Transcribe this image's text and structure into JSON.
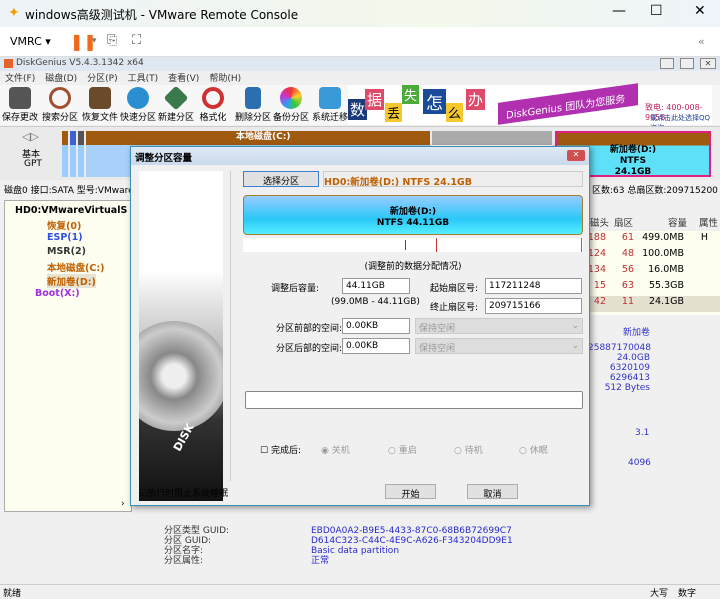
{
  "window": {
    "title": "windows高级测试机 - VMware Remote Console",
    "vmrc_label": "VMRC"
  },
  "app": {
    "title": "DiskGenius V5.4.3.1342 x64"
  },
  "menu": [
    "文件(F)",
    "磁盘(D)",
    "分区(P)",
    "工具(T)",
    "查看(V)",
    "帮助(H)"
  ],
  "toolbar": [
    "保存更改",
    "搜索分区",
    "恢复文件",
    "快速分区",
    "新建分区",
    "格式化",
    "删除分区",
    "备份分区",
    "系统迁移"
  ],
  "banner": {
    "chars": [
      "数",
      "据",
      "丢",
      "失",
      "怎",
      "么",
      "办"
    ],
    "slogan": "DiskGenius 团队为您服务",
    "phone": "致电: 400-008-9958",
    "qq": "或点击此处选择QQ咨询"
  },
  "diskmap": {
    "type_line1": "基本",
    "type_line2": "GPT",
    "c_label": "本地磁盘(C:)",
    "d_label": "新加卷(D:)",
    "d_fs": "NTFS",
    "d_size": "24.1GB"
  },
  "diskinfo": {
    "left": "磁盘0 接口:SATA  型号:VMware",
    "right": "区数:63  总扇区数:209715200"
  },
  "tree": {
    "root": "HD0:VMwareVirtualS",
    "items": [
      "恢复(0)",
      "ESP(1)",
      "MSR(2)",
      "本地磁盘(C:)",
      "新加卷(D:)"
    ],
    "boot": "Boot(X:)"
  },
  "table": {
    "headers": [
      "磁头",
      "扇区",
      "容量",
      "属性"
    ],
    "rows": [
      [
        "188",
        "61",
        "499.0MB",
        "H"
      ],
      [
        "124",
        "48",
        "100.0MB",
        ""
      ],
      [
        "134",
        "56",
        "16.0MB",
        ""
      ],
      [
        "15",
        "63",
        "55.3GB",
        ""
      ],
      [
        "42",
        "11",
        "24.1GB",
        ""
      ]
    ]
  },
  "details": {
    "name": "新加卷",
    "values": [
      "25887170048",
      "24.0GB",
      "6320109",
      "6296413",
      "512 Bytes"
    ],
    "v2": "3.1",
    "v3": "4096"
  },
  "bottom": {
    "labels": [
      "分区类型 GUID:",
      "分区 GUID:",
      "分区名字:",
      "分区属性:"
    ],
    "values": [
      "EBD0A0A2-B9E5-4433-87C0-68B6B72699C7",
      "D614C323-C44C-4E9C-A626-F343204DD9E1",
      "Basic data partition",
      "正常"
    ]
  },
  "status": {
    "left": "就绪",
    "caps": "大写",
    "num": "数字"
  },
  "dialog": {
    "title": "调整分区容量",
    "select_button": "选择分区",
    "selected": "HD0:新加卷(D:) NTFS 24.1GB",
    "bar_name": "新加卷(D:)",
    "bar_info": "NTFS 44.11GB",
    "caption": "(调整前的数据分配情况)",
    "size_label": "调整后容量:",
    "size_value": "44.11GB",
    "range": "(99.0MB - 44.11GB)",
    "start_label": "起始扇区号:",
    "start_value": "117211248",
    "end_label": "终止扇区号:",
    "end_value": "209715166",
    "before_label": "分区前部的空间:",
    "before_value": "0.00KB",
    "before_option": "保持空闲",
    "after_label": "分区后部的空间:",
    "after_value": "0.00KB",
    "after_option": "保持空闲",
    "done_label": "完成后:",
    "radios": [
      "关机",
      "重启",
      "待机",
      "休眠"
    ],
    "prevent_sleep": "执行时阻止系统睡眠",
    "start_button": "开始",
    "cancel_button": "取消",
    "brand": "DISKGENIUS"
  }
}
